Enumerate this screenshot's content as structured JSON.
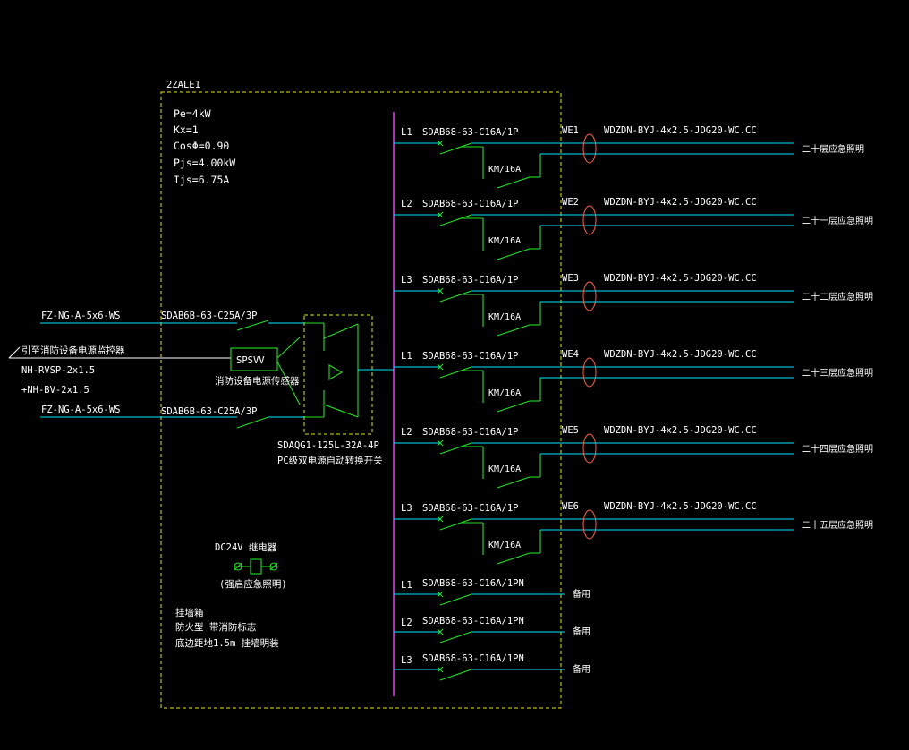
{
  "panel": {
    "name": "2ZALE1",
    "params": [
      "Pe=4kW",
      "Kx=1",
      "CosΦ=0.90",
      "Pjs=4.00kW",
      "Ijs=6.75A"
    ]
  },
  "incoming": {
    "cable1": "FZ-NG-A-5x6-WS",
    "breaker1": "SDAB6B-63-C25A/3P",
    "cable2": "FZ-NG-A-5x6-WS",
    "breaker2": "SDAB6B-63-C25A/3P",
    "monitor_note": "引至消防设备电源监控器",
    "monitor_cable1": "NH-RVSP-2x1.5",
    "monitor_cable2": "+NH-BV-2x1.5",
    "sensor_box": "SPSVV",
    "sensor_label": "消防设备电源传感器",
    "ats_model": "SDAQG1-125L-32A-4P",
    "ats_label": "PC级双电源自动转换开关"
  },
  "circuits": [
    {
      "phase": "L1",
      "breaker": "SDAB68-63-C16A/1P",
      "contactor": "KM/16A",
      "id": "WE1",
      "cable": "WDZDN-BYJ-4x2.5-JDG20-WC.CC",
      "load": "二十层应急照明"
    },
    {
      "phase": "L2",
      "breaker": "SDAB68-63-C16A/1P",
      "contactor": "KM/16A",
      "id": "WE2",
      "cable": "WDZDN-BYJ-4x2.5-JDG20-WC.CC",
      "load": "二十一层应急照明"
    },
    {
      "phase": "L3",
      "breaker": "SDAB68-63-C16A/1P",
      "contactor": "KM/16A",
      "id": "WE3",
      "cable": "WDZDN-BYJ-4x2.5-JDG20-WC.CC",
      "load": "二十二层应急照明"
    },
    {
      "phase": "L1",
      "breaker": "SDAB68-63-C16A/1P",
      "contactor": "KM/16A",
      "id": "WE4",
      "cable": "WDZDN-BYJ-4x2.5-JDG20-WC.CC",
      "load": "二十三层应急照明"
    },
    {
      "phase": "L2",
      "breaker": "SDAB68-63-C16A/1P",
      "contactor": "KM/16A",
      "id": "WE5",
      "cable": "WDZDN-BYJ-4x2.5-JDG20-WC.CC",
      "load": "二十四层应急照明"
    },
    {
      "phase": "L3",
      "breaker": "SDAB68-63-C16A/1P",
      "contactor": "KM/16A",
      "id": "WE6",
      "cable": "WDZDN-BYJ-4x2.5-JDG20-WC.CC",
      "load": "二十五层应急照明"
    }
  ],
  "spares": [
    {
      "phase": "L1",
      "breaker": "SDAB68-63-C16A/1PN",
      "label": "备用"
    },
    {
      "phase": "L2",
      "breaker": "SDAB68-63-C16A/1PN",
      "label": "备用"
    },
    {
      "phase": "L3",
      "breaker": "SDAB68-63-C16A/1PN",
      "label": "备用"
    }
  ],
  "relay": {
    "title": "DC24V 继电器",
    "note": "(强启应急照明)"
  },
  "notes": [
    "挂墙箱",
    "防火型 带消防标志",
    "底边距地1.5m 挂墙明装"
  ],
  "colors": {
    "background": "#000000",
    "wire": "#00e5ff",
    "switch": "#22e022",
    "frame": "#e6e600",
    "bus": "#c020d0",
    "ct_ring": "#ff6040",
    "text": "#ffffff"
  }
}
